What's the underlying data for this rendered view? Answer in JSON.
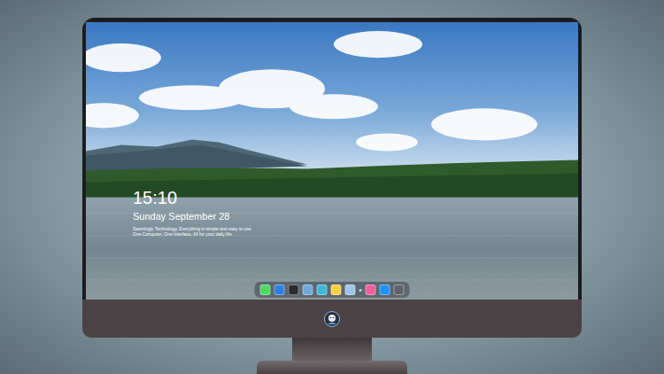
{
  "lock_screen": {
    "time": "15:10",
    "date": "Sunday September 28",
    "captions": [
      "Seemingly Technology, Everything is simple and easy to use",
      "One Computer, One Interface, All for your daily life"
    ]
  },
  "dock": {
    "items": [
      {
        "kind": "app",
        "color": "#4cd964"
      },
      {
        "kind": "app",
        "color": "#2f7de1"
      },
      {
        "kind": "app",
        "color": "#2b2b2e"
      },
      {
        "kind": "app",
        "color": "#6fa8dc"
      },
      {
        "kind": "app",
        "color": "#3fb7d9"
      },
      {
        "kind": "app",
        "color": "#f7d247"
      },
      {
        "kind": "app",
        "color": "#9fc5e8"
      },
      {
        "kind": "separator",
        "color": "#cfd8dc"
      },
      {
        "kind": "app",
        "color": "#f25c9a"
      },
      {
        "kind": "app",
        "color": "#1e90ff"
      },
      {
        "kind": "app",
        "color": "#5f6368"
      }
    ]
  }
}
